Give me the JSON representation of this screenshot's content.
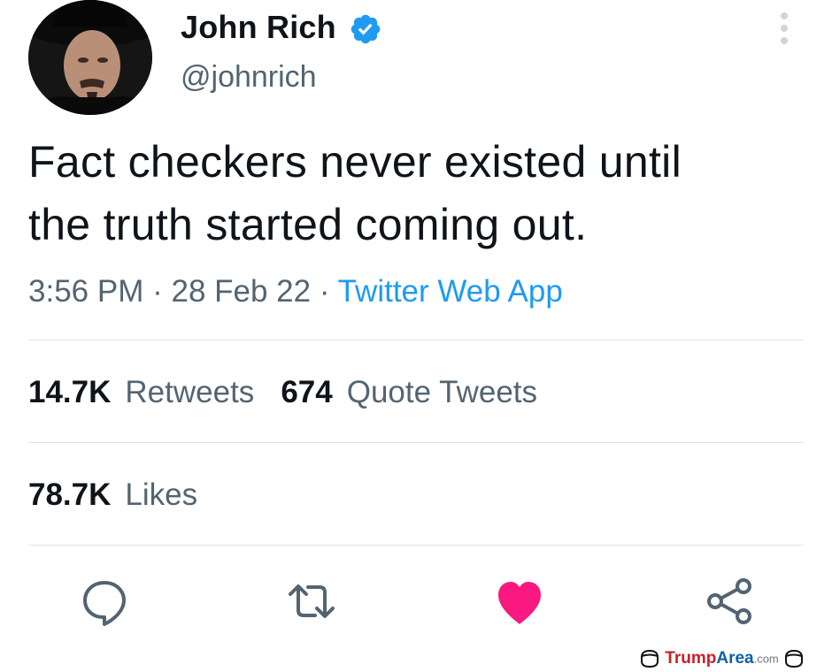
{
  "author": {
    "display_name": "John Rich",
    "handle": "@johnrich",
    "verified": true,
    "avatar_icon": "profile-photo-cowboy-hat"
  },
  "tweet": {
    "lines": [
      "Fact checkers never existed until",
      "the truth started coming out."
    ],
    "time": "3:56 PM",
    "separator": "·",
    "date": "28 Feb 22",
    "source": "Twitter Web App"
  },
  "stats": {
    "retweets_count": "14.7K",
    "retweets_label": "Retweets",
    "quotes_count": "674",
    "quotes_label": "Quote Tweets",
    "likes_count": "78.7K",
    "likes_label": "Likes"
  },
  "actions": [
    {
      "name": "reply",
      "icon": "speech-bubble-icon"
    },
    {
      "name": "retweet",
      "icon": "retweet-arrows-icon"
    },
    {
      "name": "like",
      "icon": "heart-icon",
      "active": true
    },
    {
      "name": "share",
      "icon": "share-nodes-icon"
    }
  ],
  "colors": {
    "link_blue": "#1d9bf0",
    "like_pink": "#f91880",
    "secondary_text": "#536471",
    "primary_text": "#0f1419"
  },
  "watermark": {
    "brand_a": "Trump",
    "brand_b": "Area",
    "suffix": ".com"
  }
}
